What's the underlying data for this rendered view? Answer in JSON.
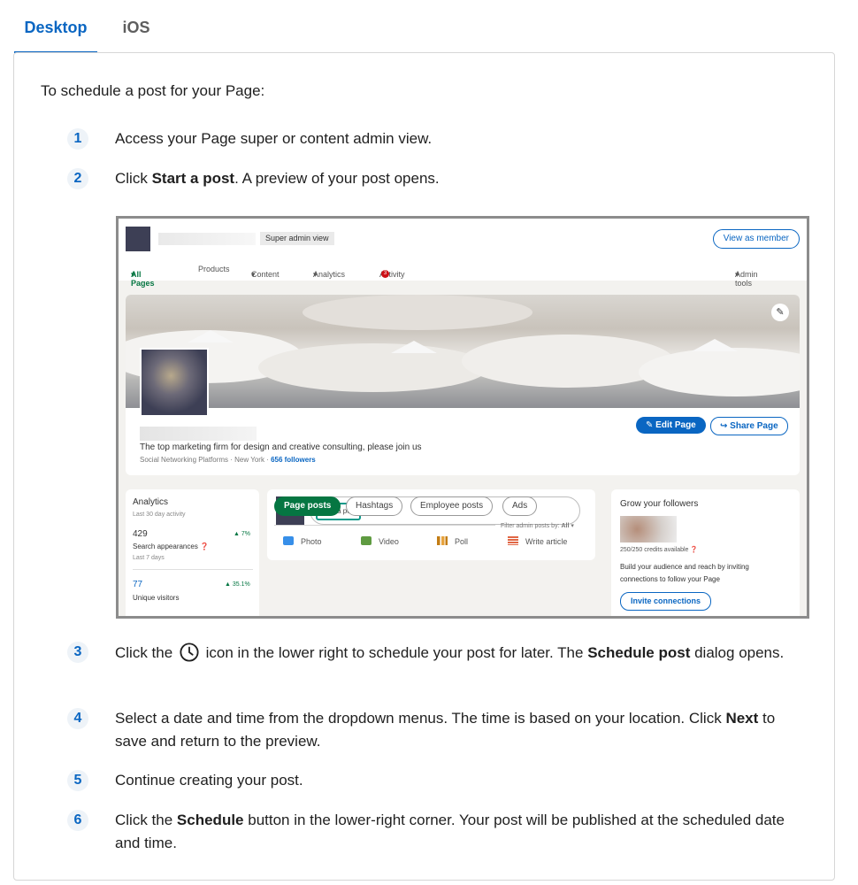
{
  "tabs": [
    {
      "label": "Desktop",
      "active": true
    },
    {
      "label": "iOS",
      "active": false
    }
  ],
  "intro": "To schedule a post for your Page:",
  "steps": [
    {
      "number": "1",
      "text": "Access your Page super or content admin view."
    },
    {
      "number": "2",
      "text_before": "Click ",
      "bold": "Start a post",
      "text_after": ". A preview of your post opens."
    },
    {
      "number": "3",
      "text_before": "Click the ",
      "icon": "clock-icon",
      "text_mid": " icon in the lower right to schedule your post for later. The ",
      "bold": "Schedule post",
      "text_after": " dialog opens."
    },
    {
      "number": "4",
      "text_before": "Select a date and time from the dropdown menus. The time is based on your location. Click ",
      "bold": "Next",
      "text_after": " to save and return to the preview."
    },
    {
      "number": "5",
      "text": "Continue creating your post."
    },
    {
      "number": "6",
      "text_before": "Click the ",
      "bold": "Schedule",
      "text_after": " button in the lower-right corner. Your post will be published at the scheduled date and time."
    }
  ],
  "screenshot": {
    "super_admin_badge": "Super admin view",
    "view_as_member": "View as member",
    "nav": {
      "all_pages": "All Pages",
      "products": "Products",
      "content": "Content",
      "analytics": "Analytics",
      "activity": "Activity",
      "activity_count": "3",
      "admin_tools": "Admin tools"
    },
    "edit_page": "Edit Page",
    "share_page": "Share Page",
    "tagline": "The top marketing firm for design and creative consulting, please join us",
    "meta_prefix": "Social Networking Platforms · New York · ",
    "followers": "656 followers",
    "analytics": {
      "title": "Analytics",
      "subtitle": "Last 30 day activity",
      "metric1_value": "429",
      "metric1_change": "▲ 7%",
      "metric1_label": "Search appearances",
      "metric1_period": "Last 7 days",
      "metric2_value": "77",
      "metric2_change": "▲ 35.1%",
      "metric2_label": "Unique visitors"
    },
    "composer": {
      "start_post": "Start a post",
      "photo": "Photo",
      "video": "Video",
      "poll": "Poll",
      "write_article": "Write article"
    },
    "filter_pills": [
      "Page posts",
      "Hashtags",
      "Employee posts",
      "Ads"
    ],
    "filter_label": "Filter admin posts by:",
    "filter_value": "All",
    "grow": {
      "title": "Grow your followers",
      "credits": "250/250 credits available",
      "text": "Build your audience and reach by inviting connections to follow your Page",
      "invite": "Invite connections"
    }
  },
  "colors": {
    "accent": "#0a66c2",
    "green": "#057642",
    "step_badge_bg": "#eef3f8"
  }
}
